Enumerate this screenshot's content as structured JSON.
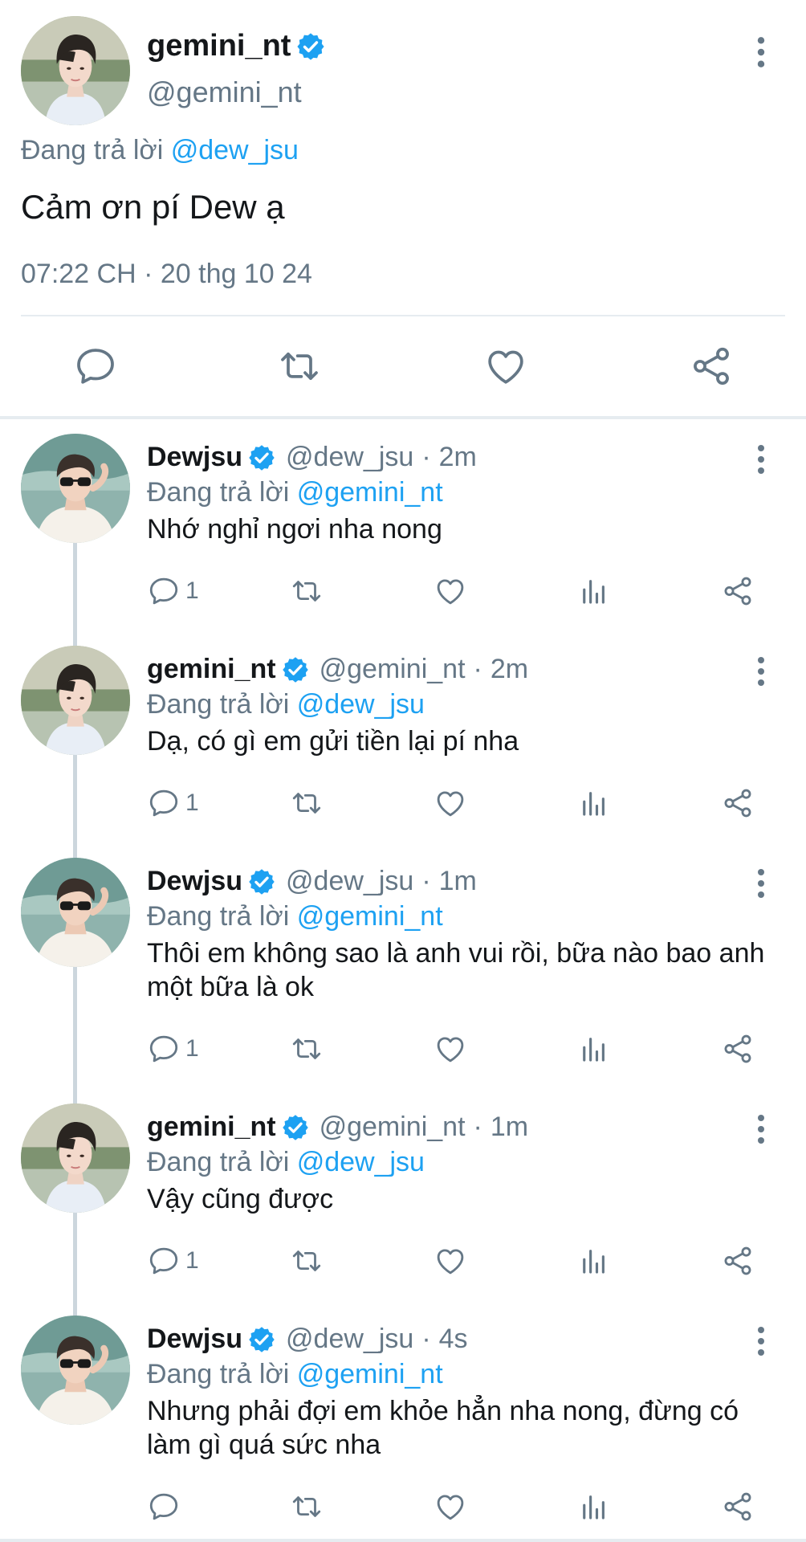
{
  "main_tweet": {
    "name": "gemini_nt",
    "handle": "@gemini_nt",
    "reply_prefix": "Đang trả lời ",
    "reply_mention": "@dew_jsu",
    "text": "Cảm ơn pí Dew ạ",
    "timestamp": "07:22 CH · 20 thg 10 24"
  },
  "replies": [
    {
      "name": "Dewjsu",
      "handle": "@dew_jsu",
      "time": "2m",
      "reply_prefix": "Đang trả lời ",
      "reply_mention": "@gemini_nt",
      "text": "Nhớ nghỉ ngơi nha nong",
      "reply_count": "1"
    },
    {
      "name": "gemini_nt",
      "handle": "@gemini_nt",
      "time": "2m",
      "reply_prefix": "Đang trả lời ",
      "reply_mention": "@dew_jsu",
      "text": "Dạ, có gì em gửi tiền lại pí nha",
      "reply_count": "1"
    },
    {
      "name": "Dewjsu",
      "handle": "@dew_jsu",
      "time": "1m",
      "reply_prefix": "Đang trả lời ",
      "reply_mention": "@gemini_nt",
      "text": "Thôi em không sao là anh vui rồi, bữa nào bao anh một bữa là ok",
      "reply_count": "1"
    },
    {
      "name": "gemini_nt",
      "handle": "@gemini_nt",
      "time": "1m",
      "reply_prefix": "Đang trả lời ",
      "reply_mention": "@dew_jsu",
      "text": "Vậy cũng được",
      "reply_count": "1"
    },
    {
      "name": "Dewjsu",
      "handle": "@dew_jsu",
      "time": "4s",
      "reply_prefix": "Đang trả lời ",
      "reply_mention": "@gemini_nt",
      "text": "Nhưng phải đợi em khỏe hẳn nha nong, đừng có làm gì quá sức nha",
      "reply_count": ""
    }
  ],
  "separator": "·",
  "colors": {
    "accent": "#1da1f2",
    "text_primary": "#14171a",
    "text_secondary": "#657786",
    "divider": "#e6ecf0",
    "thread_line": "#ccd6dd"
  },
  "icons": [
    "verified-badge-icon",
    "more-options-icon",
    "reply-icon",
    "retweet-icon",
    "like-icon",
    "analytics-icon",
    "share-icon"
  ]
}
